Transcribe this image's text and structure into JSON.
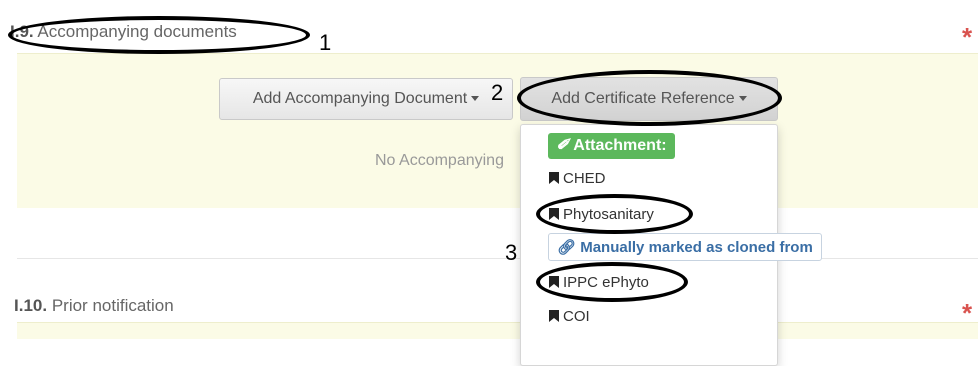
{
  "section_i9": {
    "number": "I.9.",
    "title": "Accompanying documents",
    "required_mark": "*"
  },
  "buttons": {
    "add_accompanying": "Add Accompanying Document",
    "add_certificate": "Add Certificate Reference"
  },
  "empty_state": "No Accompanying",
  "dropdown": {
    "attachment_label": "Attachment:",
    "items": [
      {
        "label": "CHED",
        "icon": "bookmark-icon"
      },
      {
        "label": "Phytosanitary",
        "icon": "bookmark-icon"
      },
      {
        "label": "IPPC ePhyto",
        "icon": "bookmark-icon"
      },
      {
        "label": "COI",
        "icon": "bookmark-icon"
      }
    ],
    "cloned_label": "Manually marked as cloned from"
  },
  "section_i10": {
    "number": "I.10.",
    "title": "Prior notification",
    "required_mark": "*"
  },
  "annotations": {
    "n1": "1",
    "n2": "2",
    "n3": "3"
  },
  "colors": {
    "panel_bg": "#fbfbe6",
    "required": "#d9534f",
    "attachment_badge": "#5cb85c",
    "cloned_text": "#3a6ea5"
  }
}
